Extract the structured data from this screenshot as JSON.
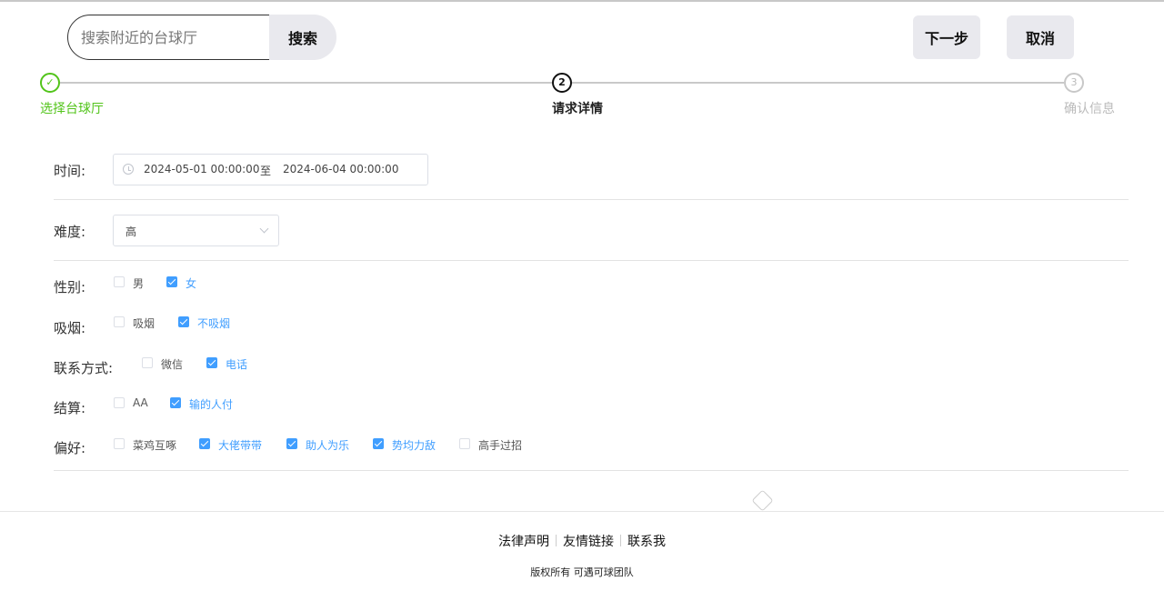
{
  "header": {
    "search_placeholder": "搜索附近的台球厅",
    "search_button": "搜索",
    "next_button": "下一步",
    "cancel_button": "取消"
  },
  "steps": [
    {
      "index": "✓",
      "label": "选择台球厅",
      "status": "done"
    },
    {
      "index": "2",
      "label": "请求详情",
      "status": "active"
    },
    {
      "index": "3",
      "label": "确认信息",
      "status": "pending"
    }
  ],
  "form": {
    "time": {
      "label": "时间:",
      "start": "2024-05-01 00:00:00",
      "separator": "至",
      "end": "2024-06-04 00:00:00"
    },
    "difficulty": {
      "label": "难度:",
      "value": "高"
    },
    "gender": {
      "label": "性别:",
      "options": [
        {
          "text": "男",
          "checked": false
        },
        {
          "text": "女",
          "checked": true
        }
      ]
    },
    "smoking": {
      "label": "吸烟:",
      "options": [
        {
          "text": "吸烟",
          "checked": false
        },
        {
          "text": "不吸烟",
          "checked": true
        }
      ]
    },
    "contact": {
      "label": "联系方式:",
      "options": [
        {
          "text": "微信",
          "checked": false
        },
        {
          "text": "电话",
          "checked": true
        }
      ]
    },
    "payment": {
      "label": "结算:",
      "options": [
        {
          "text": "AA",
          "checked": false
        },
        {
          "text": "输的人付",
          "checked": true
        }
      ]
    },
    "preference": {
      "label": "偏好:",
      "options": [
        {
          "text": "菜鸡互啄",
          "checked": false
        },
        {
          "text": "大佬带带",
          "checked": true
        },
        {
          "text": "助人为乐",
          "checked": true
        },
        {
          "text": "势均力敌",
          "checked": true
        },
        {
          "text": "高手过招",
          "checked": false
        }
      ]
    }
  },
  "footer": {
    "links": [
      "法律声明",
      "友情链接",
      "联系我"
    ],
    "copyright": "版权所有 可遇可球团队"
  },
  "colors": {
    "accent": "#409eff",
    "success": "#52c41a",
    "button_bg": "#e9e9ee"
  }
}
